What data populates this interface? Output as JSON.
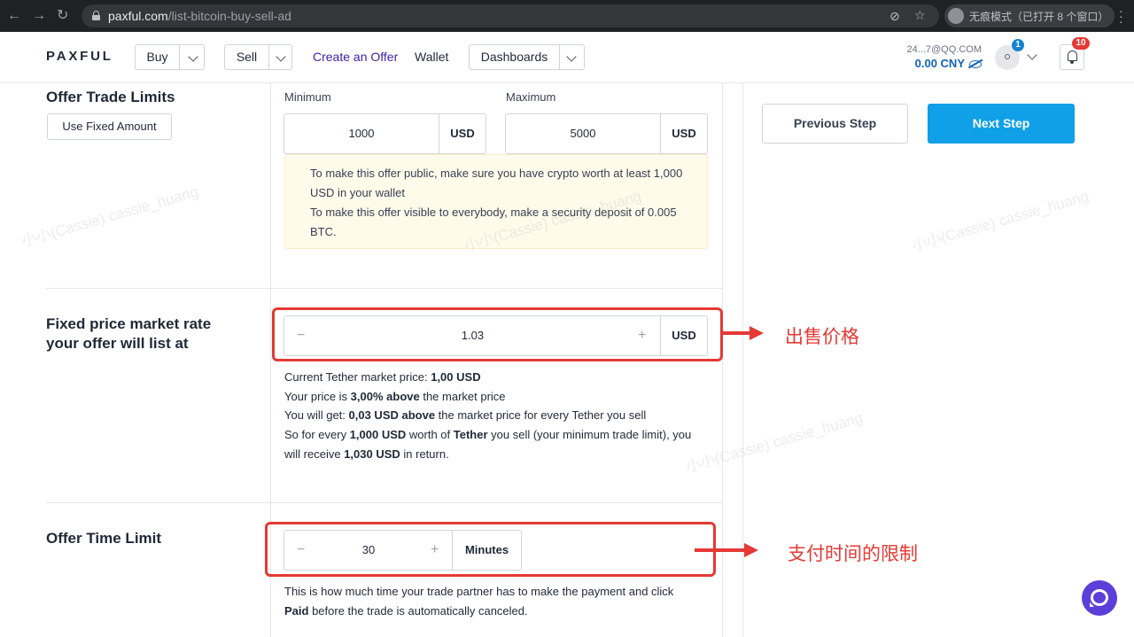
{
  "browser": {
    "url_domain": "paxful.com",
    "url_path": "/list-bitcoin-buy-sell-ad",
    "incognito_label": "无痕模式（已打开 8 个窗口）"
  },
  "header": {
    "logo": "PAXFUL",
    "buy_label": "Buy",
    "sell_label": "Sell",
    "create_offer": "Create an Offer",
    "wallet": "Wallet",
    "dashboards": "Dashboards",
    "account_email": "24...7@QQ.COM",
    "balance": "0.00 CNY",
    "profile_badge": "1",
    "notification_badge": "10"
  },
  "trade_limits": {
    "title": "Offer Trade Limits",
    "fixed_button": "Use Fixed Amount",
    "min_label": "Minimum",
    "min_value": "1000",
    "min_unit": "USD",
    "max_label": "Maximum",
    "max_value": "5000",
    "max_unit": "USD",
    "notice_line1": "To make this offer public, make sure you have crypto worth at least 1,000 USD in your wallet",
    "notice_line2": "To make this offer visible to everybody, make a security deposit of 0.005 BTC."
  },
  "fixed_price": {
    "title_line1": "Fixed price market rate",
    "title_line2": "your offer will list at",
    "minus": "−",
    "plus": "+",
    "value": "1.03",
    "unit": "USD",
    "l1_a": "Current Tether market price: ",
    "l1_b": "1,00 USD",
    "l2_a": "Your price is ",
    "l2_b": "3,00% above",
    "l2_c": " the market price",
    "l3_a": "You will get: ",
    "l3_b": "0,03 USD above",
    "l3_c": " the market price for every Tether you sell",
    "l4_a": "So for every ",
    "l4_b": "1,000 USD",
    "l4_c": " worth of ",
    "l4_d": "Tether",
    "l4_e": " you sell (your minimum trade limit), you",
    "l5_a": "will receive ",
    "l5_b": "1,030 USD",
    "l5_c": " in return."
  },
  "time_limit": {
    "title": "Offer Time Limit",
    "minus": "−",
    "plus": "+",
    "value": "30",
    "unit": "Minutes",
    "desc_a": "This is how much time your trade partner has to make the payment and click",
    "desc_b": "Paid",
    "desc_c": " before the trade is automatically canceled."
  },
  "actions": {
    "previous": "Previous Step",
    "next": "Next Step"
  },
  "annotations": {
    "price_note": "出售价格",
    "time_note": "支付时间的限制"
  },
  "watermark": "小小(Cassie) cassie_huang",
  "colors": {
    "accent_blue": "#10a0e8",
    "link_purple": "#3b1fa8",
    "annotation_red": "#e53935",
    "chat_purple": "#5b3fd9"
  }
}
